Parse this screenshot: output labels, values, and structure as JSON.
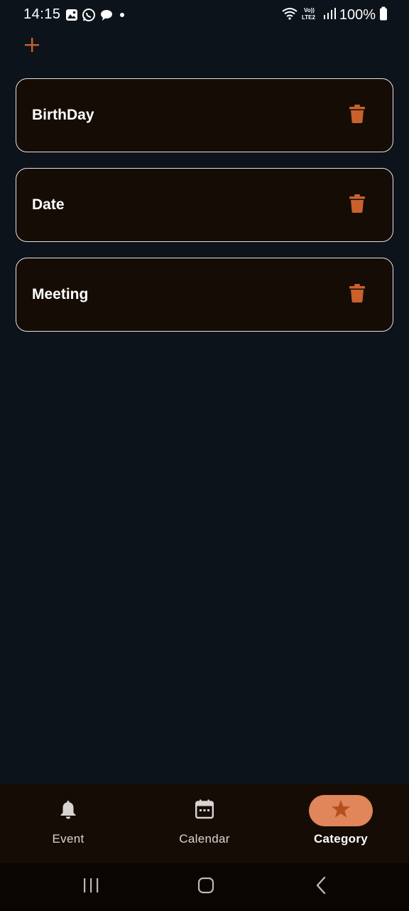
{
  "status_bar": {
    "time": "14:15",
    "battery": "100%",
    "left_icons": [
      "gallery-icon",
      "whatsapp-icon",
      "chat-icon",
      "dot-icon"
    ],
    "right_icons": [
      "wifi-icon",
      "volte-lte2-icon",
      "signal-icon",
      "battery-icon"
    ]
  },
  "toolbar": {
    "add_icon": "plus-icon"
  },
  "categories": [
    {
      "name": "BirthDay",
      "action_icon": "trash-icon"
    },
    {
      "name": "Date",
      "action_icon": "trash-icon"
    },
    {
      "name": "Meeting",
      "action_icon": "trash-icon"
    }
  ],
  "bottom_nav": {
    "items": [
      {
        "label": "Event",
        "icon": "bell-icon",
        "active": false
      },
      {
        "label": "Calendar",
        "icon": "calendar-icon",
        "active": false
      },
      {
        "label": "Category",
        "icon": "star-icon",
        "active": true
      }
    ]
  },
  "system_nav": {
    "buttons": [
      "recents-icon",
      "home-icon",
      "back-icon"
    ]
  },
  "colors": {
    "background": "#0d131b",
    "card": "#150c06",
    "card_border": "#e8e2df",
    "accent": "#c9612c",
    "active_pill": "#e0865a"
  }
}
